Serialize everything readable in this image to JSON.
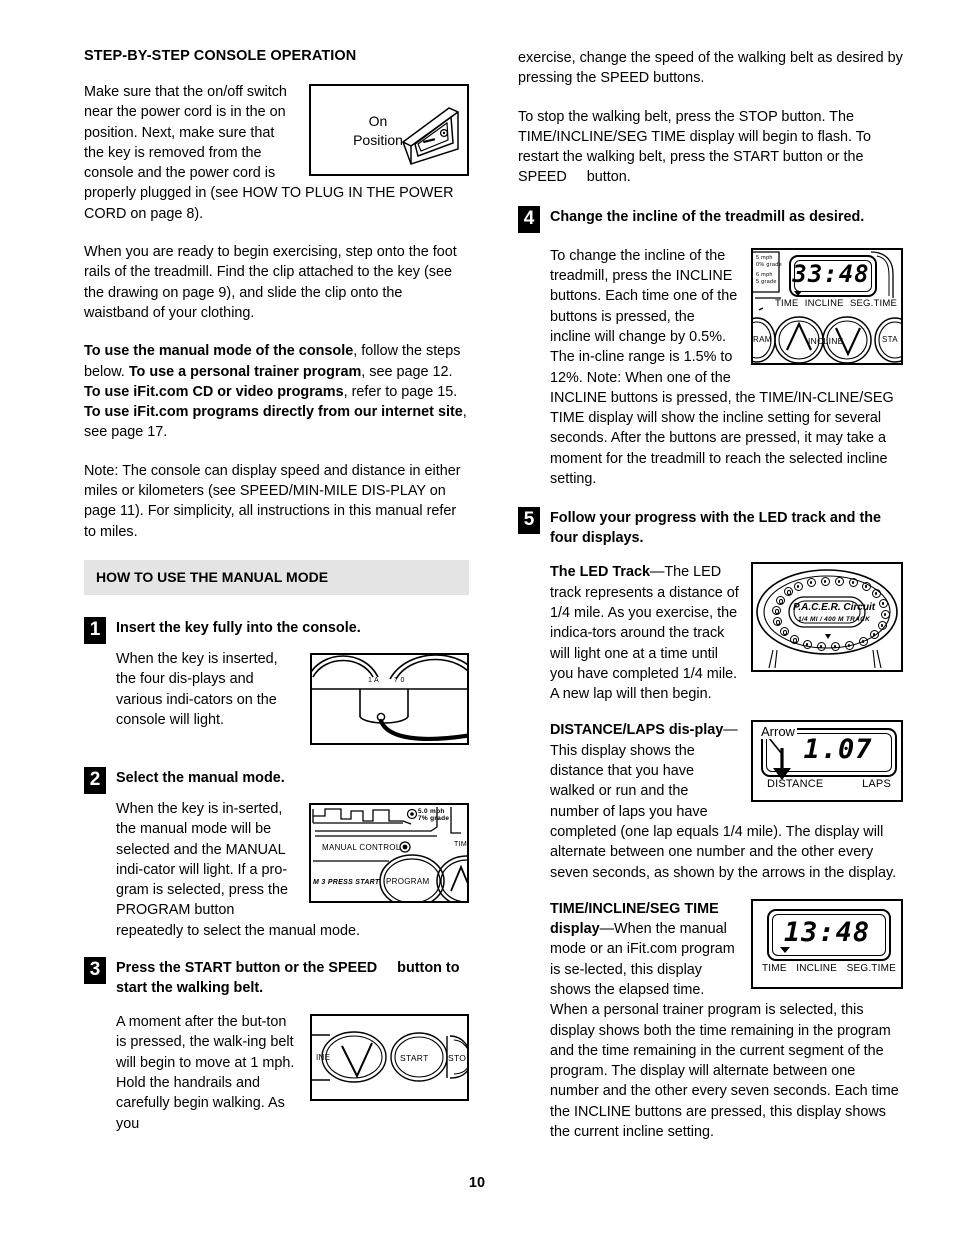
{
  "document": {
    "page_number": "10"
  },
  "left_column": {
    "section_title": "STEP-BY-STEP CONSOLE OPERATION",
    "intro_para_wrap": "Make sure that the on/off switch near the power cord is in the on position. Next, make sure that the key is removed from the console and the power cord is properly plugged in (see HOW TO PLUG IN THE POWER CORD on page 8).",
    "para_step_onto": "When you are ready to begin exercising, step onto the foot rails of the treadmill. Find the clip attached to the key (see the drawing on page 9), and slide the clip onto the waistband of your clothing.",
    "para_modes": {
      "b1": "To use the manual mode of the console",
      "t1": ", follow the steps below. ",
      "b2": "To use a personal trainer program",
      "t2": ", see page 12. ",
      "b3": "To use iFit.com CD or video programs",
      "t3": ", refer to page 15. ",
      "b4": "To use iFit.com programs directly from our internet site",
      "t4": ", see page 17."
    },
    "para_note": "Note: The console can display speed and distance in either miles or kilometers (see SPEED/MIN-MILE DIS-PLAY on page 11). For simplicity, all instructions in this manual refer to miles.",
    "band_heading": "HOW TO USE THE MANUAL MODE",
    "steps": [
      {
        "number": "1",
        "heading": "Insert the key fully into the console.",
        "body": "When the key is inserted, the four dis-plays and various indi-cators on the console will light."
      },
      {
        "number": "2",
        "heading": "Select the manual mode.",
        "body": "When the key is in-serted, the manual mode will be selected and the MANUAL indi-cator will light. If a pro-gram is selected, press the PROGRAM button repeatedly to select the manual mode."
      },
      {
        "number": "3",
        "heading": "Press the START button or the SPEED     button to start the walking belt.",
        "body": "A moment after the but-ton is pressed, the walk-ing belt will begin to move at 1 mph. Hold the handrails and carefully begin walking. As you"
      }
    ]
  },
  "right_column": {
    "para_continue": "exercise, change the speed of the walking belt as desired by pressing the SPEED buttons.",
    "para_stop": "To stop the walking belt, press the STOP button. The TIME/INCLINE/SEG TIME display will begin to flash. To restart the walking belt, press the START button or the SPEED     button.",
    "steps": [
      {
        "number": "4",
        "heading": "Change the incline of the treadmill as desired.",
        "body": "To change the incline of the treadmill, press the INCLINE buttons. Each time one of the buttons is pressed, the incline will change by 0.5%. The in-cline range is 1.5% to 12%. Note: When one of the INCLINE buttons is pressed, the TIME/IN-CLINE/SEG TIME display will show the incline setting for several seconds. After the buttons are pressed, it may take a moment for the treadmill to reach the selected incline setting."
      },
      {
        "number": "5",
        "heading": "Follow your progress with the LED track and the four displays.",
        "body": ""
      }
    ],
    "led_track": {
      "bold_label": "The LED Track",
      "dash": "—",
      "text": "The LED track represents a distance of 1/4 mile. As you exercise, the indica-tors around the track will light one at a time until you have completed 1/4 mile. A new lap will then begin."
    },
    "distance_laps": {
      "bold_label": "DISTANCE/LAPS dis-play",
      "dash": "—",
      "text": "This display shows the distance that you have walked or run and the number of laps you have completed (one lap equals 1/4 mile). The display will alternate between one number and the other every seven seconds, as shown by the arrows in the display."
    },
    "time_incline": {
      "bold_label": "TIME/INCLINE/SEG TIME display",
      "dash": "—",
      "text": "When the manual mode or an iFit.com program is se-lected, this display shows the elapsed time. When a personal trainer program is selected, this display shows both the time remaining in the program and the time remaining in the current segment of the program. The display will alternate between one number and the other every seven seconds. Each time the INCLINE buttons are pressed, this display shows the current incline setting."
    }
  },
  "figures": {
    "switch": {
      "label_line1": "On",
      "label_line2": "Position"
    },
    "key_console": {
      "tick_left": "1 A",
      "tick_right": "7 0"
    },
    "manual_control": {
      "profile_caption_line1": "5.0 mph",
      "profile_caption_line2": "7% grade",
      "manual_label": "MANUAL CONTROL",
      "program_btn": "PROGRAM",
      "press_start": "M 3 PRESS START",
      "time_label": "TIM"
    },
    "start_stop": {
      "incline_partial": "INE",
      "start_btn": "START",
      "stop_btn": "STO"
    },
    "incline_panel": {
      "display_value": "33:48",
      "caption_time": "TIME",
      "caption_incline": "INCLINE",
      "caption_segtime": "SEG.TIME",
      "program_partial": "RAM",
      "incline_btn": "INCLINE",
      "start_partial": "STA",
      "side_line1": "5 mph",
      "side_line2": "0% grade",
      "side_line3": "6 mph",
      "side_line4": "5 grade"
    },
    "led_track_fig": {
      "brand": "P.A.C.E.R. Circuit",
      "subtitle": "1/4 MI / 400 M TRACK"
    },
    "distance_fig": {
      "arrow_label": "Arrow",
      "display_value": "1.07",
      "caption_distance": "DISTANCE",
      "caption_laps": "LAPS"
    },
    "time_fig": {
      "display_value": "13:48",
      "caption_time": "TIME",
      "caption_incline": "INCLINE",
      "caption_segtime": "SEG.TIME"
    }
  }
}
